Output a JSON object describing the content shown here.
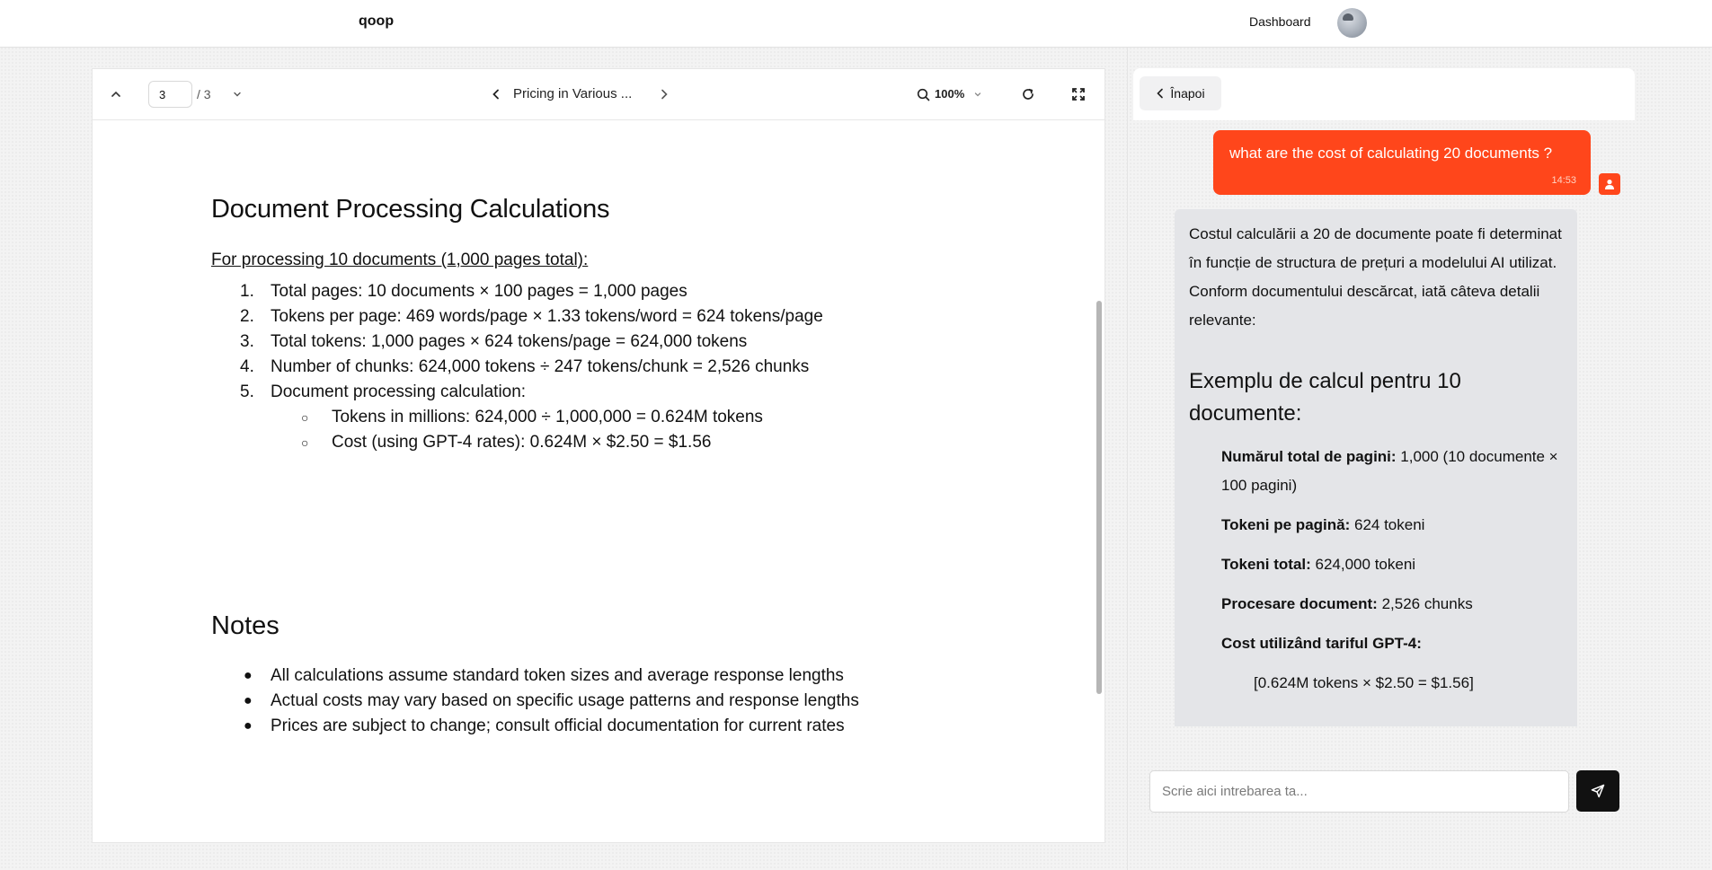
{
  "app": {
    "brand": "qoop"
  },
  "topnav": {
    "dashboard": "Dashboard"
  },
  "viewer": {
    "page_current": "3",
    "page_total": "/ 3",
    "title": "Pricing in Various ...",
    "zoom": "100%",
    "icons": {
      "prev_page": "chevron-up-icon",
      "next_page": "chevron-down-icon",
      "prev_doc": "chevron-left-icon",
      "next_doc": "chevron-right-icon",
      "zoom": "search-icon",
      "rotate": "refresh-icon",
      "fullscreen": "fullscreen-icon"
    },
    "document": {
      "heading": "Document Processing Calculations",
      "subheading": "For processing 10 documents (1,000 pages total):",
      "steps": [
        {
          "num": "1.",
          "text": "Total pages: 10 documents × 100 pages = 1,000 pages"
        },
        {
          "num": "2.",
          "text": "Tokens per page: 469 words/page × 1.33 tokens/word = 624 tokens/page"
        },
        {
          "num": "3.",
          "text": "Total tokens: 1,000 pages × 624 tokens/page = 624,000 tokens"
        },
        {
          "num": "4.",
          "text": "Number of chunks: 624,000 tokens ÷ 247 tokens/chunk = 2,526 chunks"
        },
        {
          "num": "5.",
          "text": "Document processing calculation:"
        }
      ],
      "substeps": [
        {
          "bullet": "○",
          "text": "Tokens in millions: 624,000 ÷ 1,000,000 = 0.624M tokens"
        },
        {
          "bullet": "○",
          "text": "Cost (using GPT-4 rates): 0.624M × $2.50 = $1.56"
        }
      ],
      "notes_heading": "Notes",
      "notes": [
        {
          "bullet": "●",
          "text": "All calculations assume standard token sizes and average response lengths"
        },
        {
          "bullet": "●",
          "text": "Actual costs may vary based on specific usage patterns and response lengths"
        },
        {
          "bullet": "●",
          "text": "Prices are subject to change; consult official documentation for current rates"
        }
      ]
    }
  },
  "chat": {
    "back_label": "Înapoi",
    "user_message": {
      "text": "what are the cost of calculating 20 documents ?",
      "time": "14:53"
    },
    "ai_message": {
      "intro": "Costul calculării a 20 de documente poate fi determinat în funcție de structura de prețuri a modelului AI utilizat. Conform documentului descărcat, iată câteva detalii relevante:",
      "heading": "Exemplu de calcul pentru 10 documente:",
      "items": [
        {
          "label": "Numărul total de pagini:",
          "value": " 1,000 (10 documente × 100 pagini)"
        },
        {
          "label": "Tokeni pe pagină:",
          "value": " 624 tokeni"
        },
        {
          "label": "Tokeni total:",
          "value": " 624,000 tokeni"
        },
        {
          "label": "Procesare document:",
          "value": " 2,526 chunks"
        },
        {
          "label": "Cost utilizând tariful GPT-4:",
          "value": ""
        }
      ],
      "formula": "[0.624M tokens × $2.50 = $1.56]"
    },
    "input_placeholder": "Scrie aici intrebarea ta...",
    "colors": {
      "accent": "#ff461b",
      "ai_bubble": "#e4e5e8",
      "send": "#111111"
    }
  }
}
